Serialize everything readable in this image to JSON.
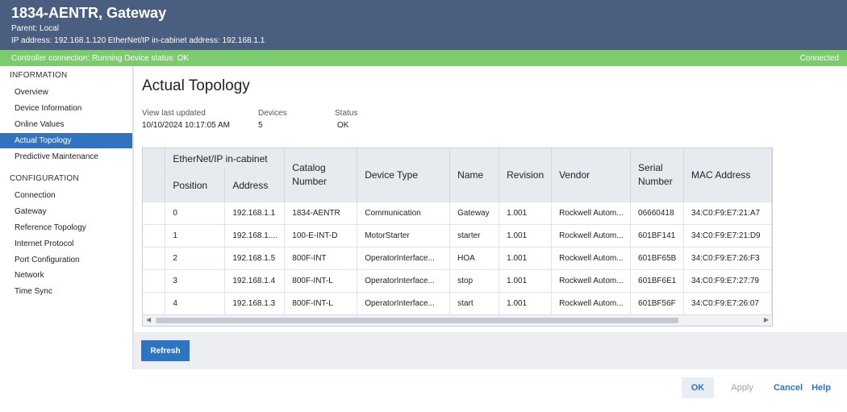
{
  "header": {
    "title": "1834-AENTR, Gateway",
    "parent": "Parent: Local",
    "address_line": "IP address: 192.168.1.120   EtherNet/IP in-cabinet address: 192.168.1.1"
  },
  "status": {
    "left": "Controller connection: Running   Device status: OK",
    "right": "Connected",
    "color": "#7ccb6e"
  },
  "sidebar": {
    "information_heading": "INFORMATION",
    "information_items": [
      "Overview",
      "Device Information",
      "Online Values",
      "Actual Topology",
      "Predictive Maintenance"
    ],
    "configuration_heading": "CONFIGURATION",
    "configuration_items": [
      "Connection",
      "Gateway",
      "Reference Topology",
      "Internet Protocol",
      "Port Configuration",
      "Network",
      "Time Sync"
    ],
    "active": "Actual Topology",
    "accent": "#2f74c3"
  },
  "main": {
    "title": "Actual Topology",
    "meta": {
      "updated_label": "View last updated",
      "updated_value": "10/10/2024 10:17:05 AM",
      "devices_label": "Devices",
      "devices_value": "5",
      "status_label": "Status",
      "status_value": "OK"
    },
    "table": {
      "group_header": "EtherNet/IP in-cabinet",
      "columns": [
        "Position",
        "Address",
        "Catalog Number",
        "Device Type",
        "Name",
        "Revision",
        "Vendor",
        "Serial Number",
        "MAC Address"
      ],
      "rows": [
        [
          "0",
          "192.168.1.1",
          "1834-AENTR",
          "Communication",
          "Gateway",
          "1.001",
          "Rockwell Autom...",
          "06660418",
          "34:C0:F9:E7:21:A7"
        ],
        [
          "1",
          "192.168.1....",
          "100-E-INT-D",
          "MotorStarter",
          "starter",
          "1.001",
          "Rockwell Autom...",
          "601BF141",
          "34:C0:F9:E7:21:D9"
        ],
        [
          "2",
          "192.168.1.5",
          "800F-INT",
          "OperatorInterface...",
          "HOA",
          "1.001",
          "Rockwell Autom...",
          "601BF65B",
          "34:C0:F9:E7:26:F3"
        ],
        [
          "3",
          "192.168.1.4",
          "800F-INT-L",
          "OperatorInterface...",
          "stop",
          "1.001",
          "Rockwell Autom...",
          "601BF6E1",
          "34:C0:F9:E7:27:79"
        ],
        [
          "4",
          "192.168.1.3",
          "800F-INT-L",
          "OperatorInterface...",
          "start",
          "1.001",
          "Rockwell Autom...",
          "601BF56F",
          "34:C0:F9:E7:26:07"
        ]
      ]
    },
    "refresh_label": "Refresh"
  },
  "footer": {
    "ok": "OK",
    "apply": "Apply",
    "cancel": "Cancel",
    "help": "Help"
  }
}
